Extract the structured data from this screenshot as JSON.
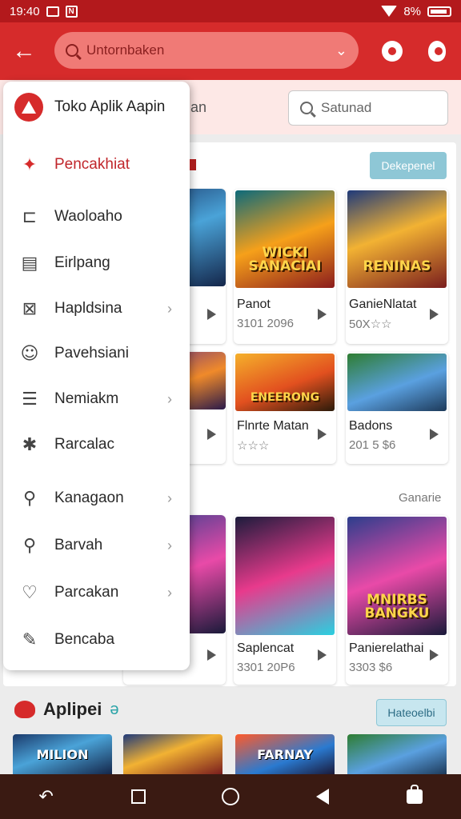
{
  "status_bar": {
    "time": "19:40",
    "mini": "N",
    "battery": "8%"
  },
  "app_bar": {
    "back_glyph": "←",
    "search_placeholder": "Untornbaken",
    "chevron_glyph": "⌄"
  },
  "page": {
    "search_fragment": "an",
    "search_placeholder": "Satunad"
  },
  "drawer": {
    "title": "Toko Aplik Aapin",
    "items": [
      {
        "label": "Pencakhiat",
        "icon": "gamepad-icon",
        "glyph": "✦"
      },
      {
        "label": "Waoloaho",
        "icon": "bookmark-icon",
        "glyph": "⊏"
      },
      {
        "label": "Eirlpang",
        "icon": "calendar-icon",
        "glyph": "▤"
      },
      {
        "label": "Hapldsina",
        "icon": "grid-x-icon",
        "glyph": "⊠"
      },
      {
        "label": "Pavehsiani",
        "icon": "smiley-icon",
        "glyph": "☺"
      },
      {
        "label": "Nemiakm",
        "icon": "list-icon",
        "glyph": "☰"
      },
      {
        "label": "Rarcalac",
        "icon": "star-gear-icon",
        "glyph": "✱"
      },
      {
        "label": "Kanagaon",
        "icon": "person-icon",
        "glyph": "⚲"
      },
      {
        "label": "Barvah",
        "icon": "search-icon",
        "glyph": "⚲"
      },
      {
        "label": "Parcakan",
        "icon": "heart-icon",
        "glyph": "♡"
      },
      {
        "label": "Bencaba",
        "icon": "edit-icon",
        "glyph": "✎"
      }
    ]
  },
  "sections": {
    "top_button": "Dekepenel",
    "middle_label": "Ganarie",
    "apps_title": "Aplipei",
    "apps_extra": "ə",
    "apps_button": "Hateoelbi"
  },
  "games_row1": [
    {
      "name": "Panot",
      "meta": "3101 2096",
      "art_title": "WICKI SANACIAI"
    },
    {
      "name": "GanieNlatat",
      "meta": "50X☆☆",
      "art_title": "RENINAS"
    }
  ],
  "games_row2": [
    {
      "name": "Flnrte Matan",
      "meta": "☆☆☆",
      "art_title": "ENEERONG"
    },
    {
      "name": "Badons",
      "meta": "201 5 $6",
      "art_title": ""
    }
  ],
  "games_row3": [
    {
      "name": "Saplencat",
      "meta": "3301 20P6",
      "art_title": ""
    },
    {
      "name": "Panierelathai",
      "meta": "3303 $6",
      "art_title": "MNIRBS BANGKU"
    }
  ],
  "bottom_art": [
    "MILION",
    "",
    "FARNAY",
    ""
  ]
}
